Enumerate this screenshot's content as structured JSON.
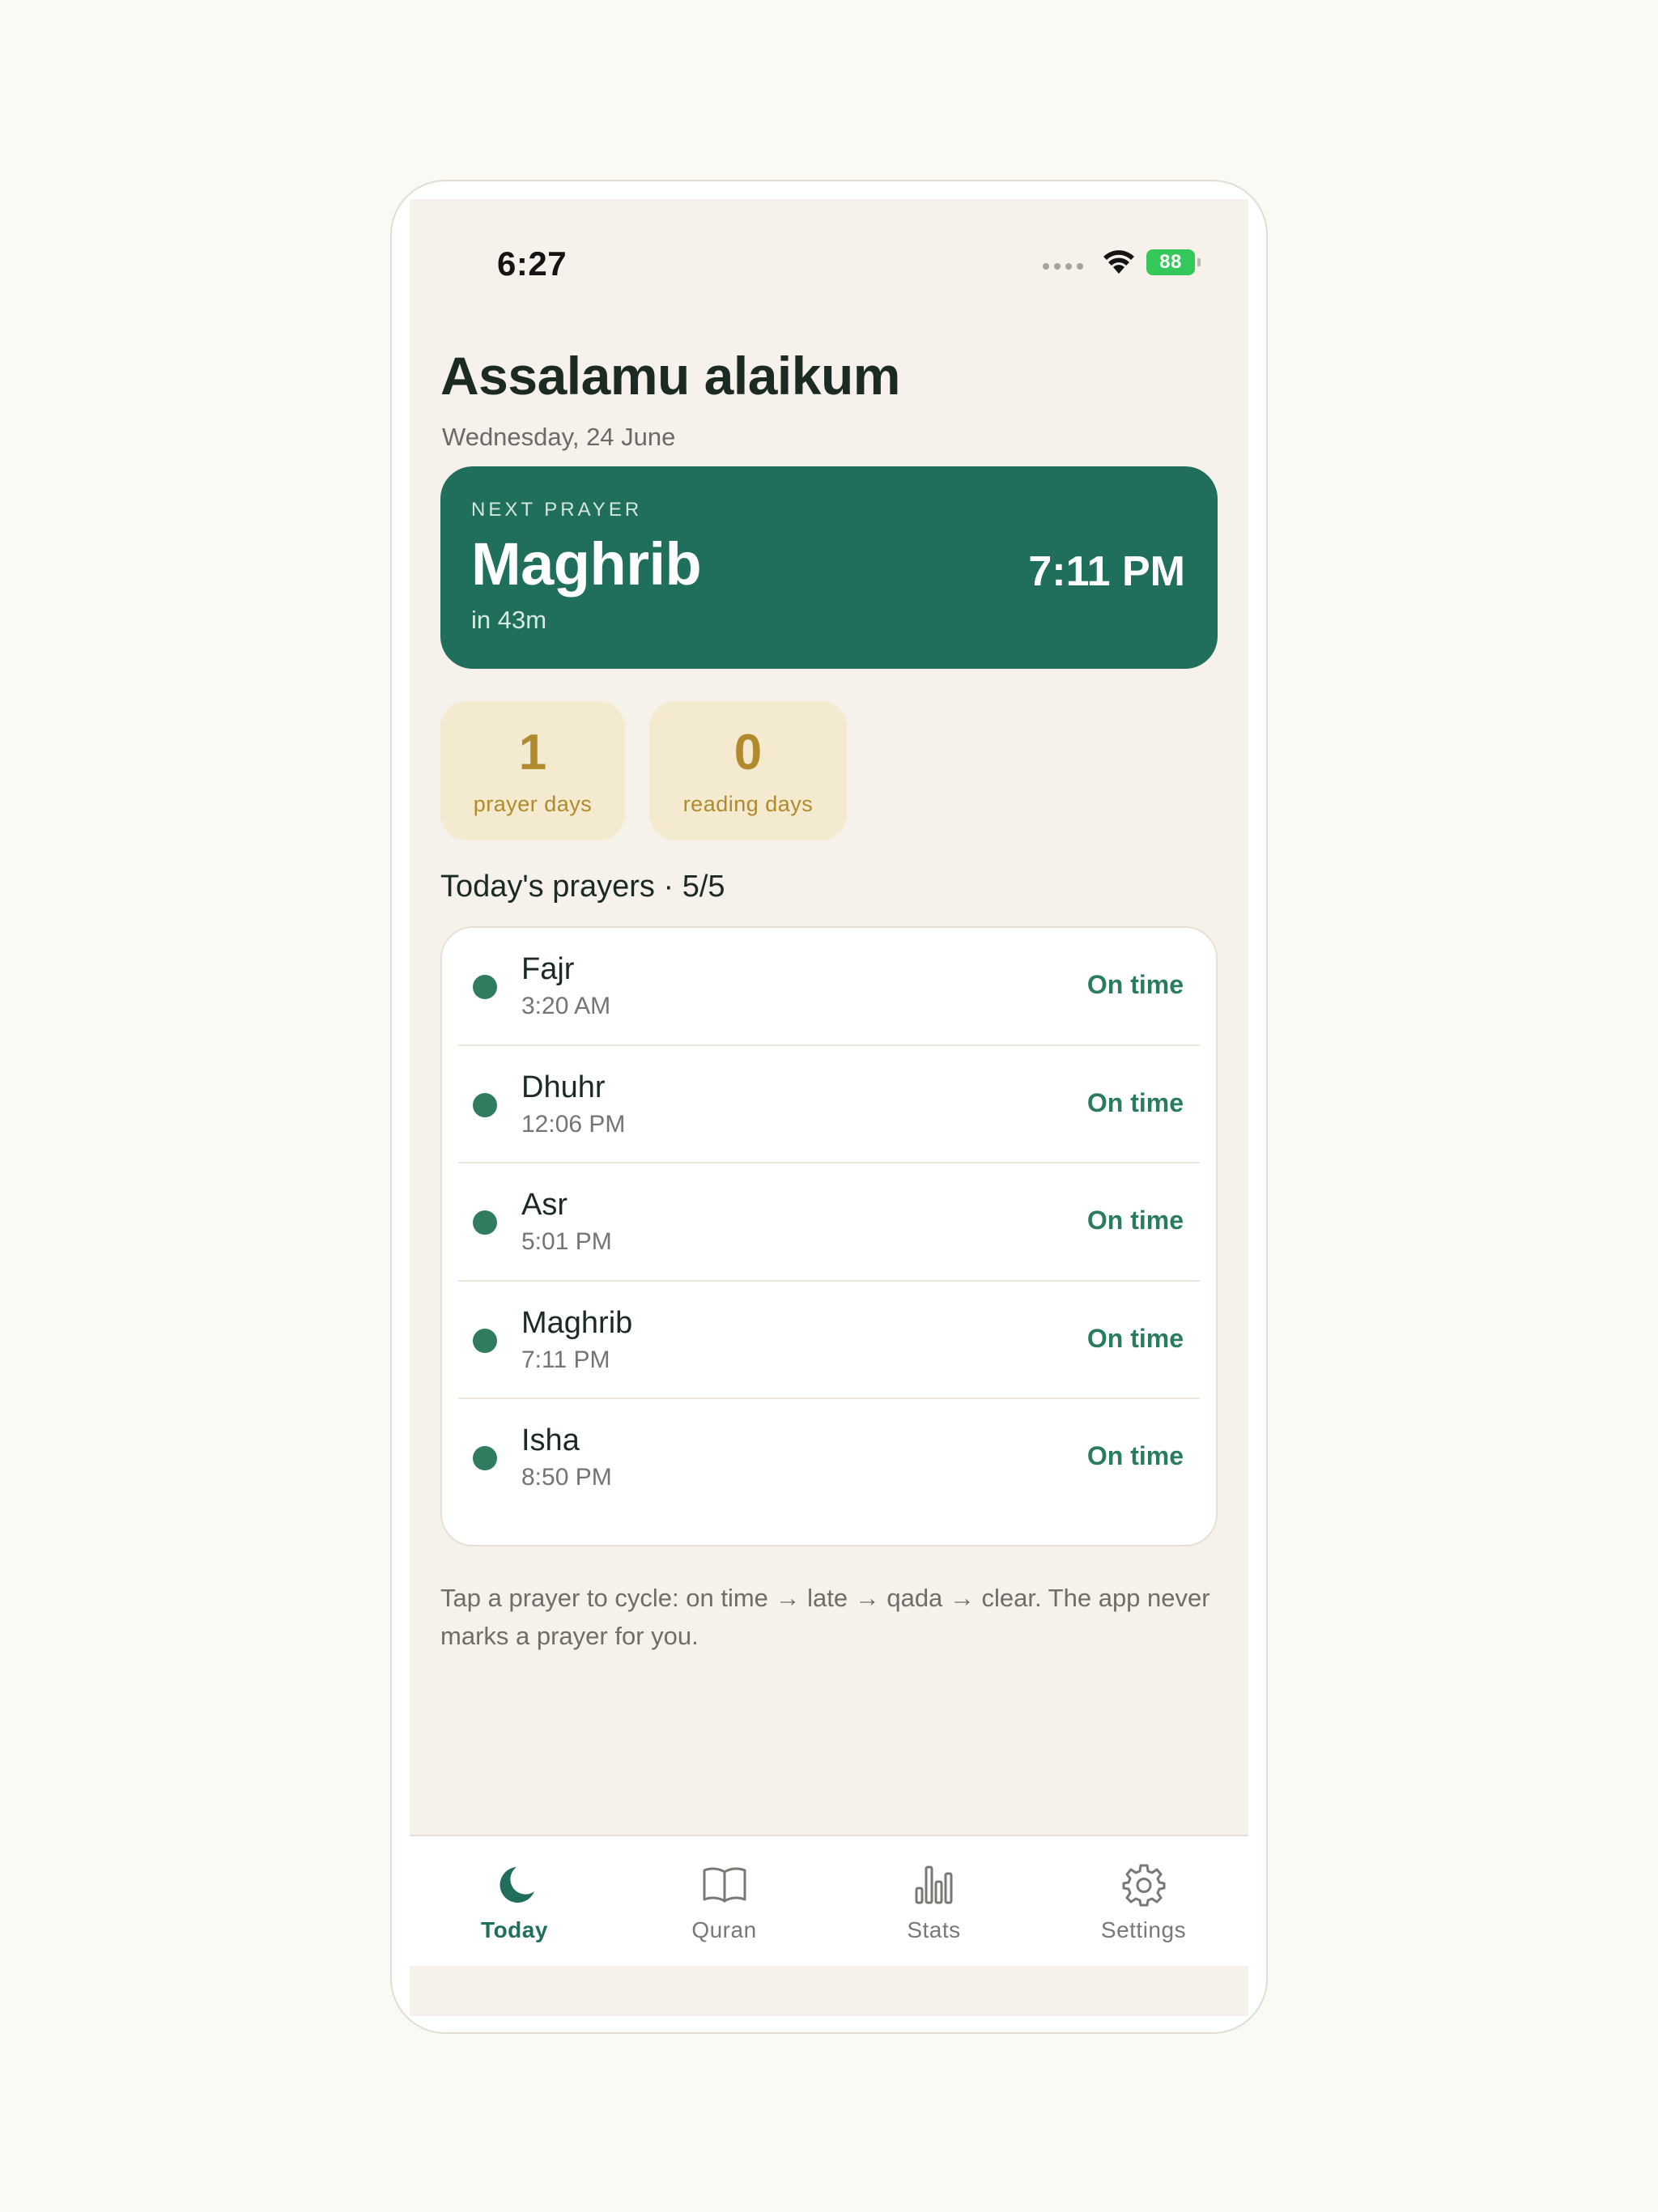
{
  "status_bar": {
    "time": "6:27",
    "battery": "88"
  },
  "header": {
    "greeting": "Assalamu alaikum",
    "date": "Wednesday, 24 June"
  },
  "next_prayer": {
    "label": "NEXT PRAYER",
    "name": "Maghrib",
    "countdown": "in 43m",
    "time": "7:11 PM"
  },
  "streaks": [
    {
      "value": "1",
      "label": "prayer days"
    },
    {
      "value": "0",
      "label": "reading days"
    }
  ],
  "prayers_section": {
    "title": "Today's prayers · 5/5"
  },
  "prayers": [
    {
      "name": "Fajr",
      "time": "3:20 AM",
      "status": "On time"
    },
    {
      "name": "Dhuhr",
      "time": "12:06 PM",
      "status": "On time"
    },
    {
      "name": "Asr",
      "time": "5:01 PM",
      "status": "On time"
    },
    {
      "name": "Maghrib",
      "time": "7:11 PM",
      "status": "On time"
    },
    {
      "name": "Isha",
      "time": "8:50 PM",
      "status": "On time"
    }
  ],
  "hint": "Tap a prayer to cycle: on time → late → qada → clear. The app never marks a prayer for you.",
  "tabs": [
    {
      "label": "Today",
      "icon": "moon-icon",
      "active": true
    },
    {
      "label": "Quran",
      "icon": "book-icon",
      "active": false
    },
    {
      "label": "Stats",
      "icon": "bar-chart-icon",
      "active": false
    },
    {
      "label": "Settings",
      "icon": "gear-icon",
      "active": false
    }
  ],
  "colors": {
    "primary": "#206e5c",
    "background": "#f6f1ea",
    "streak_tile": "#f4ead0",
    "streak_text": "#b08a2c",
    "status_green": "#2a7d5c"
  }
}
